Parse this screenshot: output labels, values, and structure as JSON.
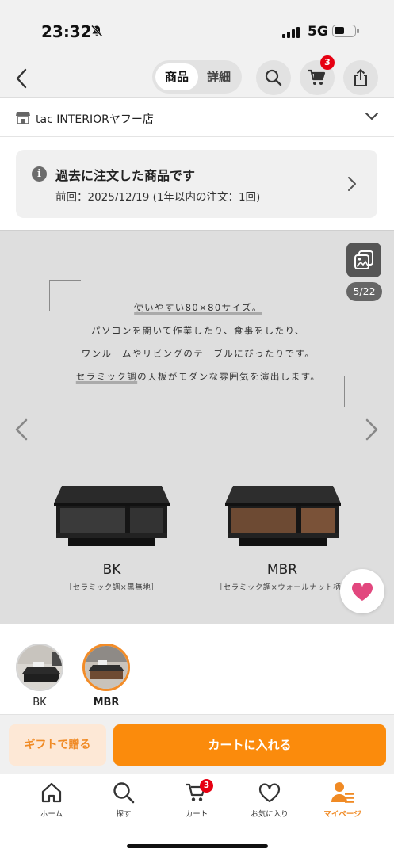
{
  "status_bar": {
    "time": "23:32",
    "network": "5G"
  },
  "header": {
    "tabs": [
      "商品",
      "詳細"
    ],
    "active_tab": "商品",
    "cart_count": "3"
  },
  "store": {
    "name": "tac INTERIORヤフー店"
  },
  "past_order": {
    "title": "過去に注文した商品です",
    "subtitle": "前回：2025/12/19 (1年以内の注文：1回)"
  },
  "gallery": {
    "counter": "5/22",
    "description": {
      "line1_highlight": "使いやすい80×80サイズ。",
      "line2": "パソコンを開いて作業したり、食事をしたり、",
      "line3": "ワンルームやリビングのテーブルにぴったりです。",
      "line4_highlight": "セラミック調",
      "line4_rest": "の天板がモダンな雰囲気を演出します。"
    },
    "variants": [
      {
        "code": "BK",
        "note": "［セラミック調×黒無地］"
      },
      {
        "code": "MBR",
        "note": "［セラミック調×ウォールナット柄］"
      }
    ]
  },
  "variant_selector": {
    "options": [
      "BK",
      "MBR"
    ],
    "selected": "MBR"
  },
  "actions": {
    "gift_label": "ギフトで贈る",
    "cart_label": "カートに入れる"
  },
  "tab_bar": {
    "items": [
      "ホーム",
      "探す",
      "カート",
      "お気に入り",
      "マイページ"
    ],
    "active": "マイページ",
    "cart_badge": "3"
  },
  "colors": {
    "accent": "#fb8b0c",
    "badge": "#e60012",
    "favorite": "#e2477e"
  }
}
